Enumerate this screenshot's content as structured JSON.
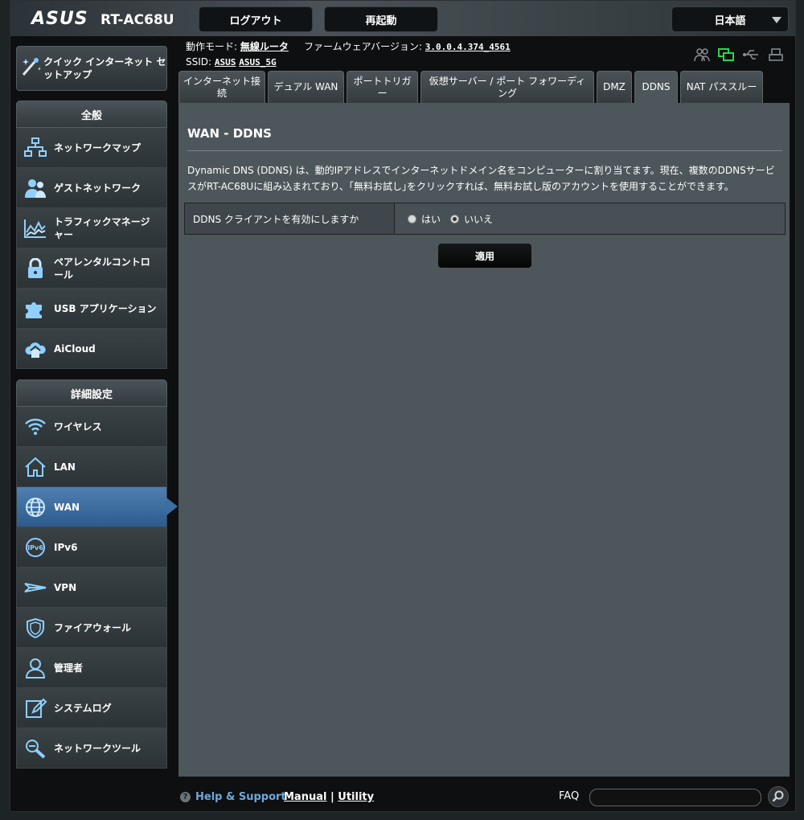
{
  "header": {
    "logo": "ASUS",
    "model": "RT-AC68U",
    "logout": "ログアウト",
    "reboot": "再起動",
    "language": "日本語"
  },
  "status": {
    "mode_label": "動作モード:",
    "mode_value": "無線ルータ",
    "fw_label": "ファームウェアバージョン:",
    "fw_value": "3.0.0.4.374_4561",
    "ssid_label": "SSID:",
    "ssid_1": "ASUS",
    "ssid_2": "ASUS_5G"
  },
  "sidebar": {
    "qis": "クイック インターネット セットアップ",
    "general_title": "全般",
    "general": [
      {
        "label": "ネットワークマップ",
        "icon": "network-map-icon"
      },
      {
        "label": "ゲストネットワーク",
        "icon": "guest-network-icon"
      },
      {
        "label": "トラフィックマネージャー",
        "icon": "traffic-manager-icon"
      },
      {
        "label": "ペアレンタルコントロール",
        "icon": "parental-control-icon"
      },
      {
        "label": "USB アプリケーション",
        "icon": "usb-app-icon"
      },
      {
        "label": "AiCloud",
        "icon": "aicloud-icon"
      }
    ],
    "advanced_title": "詳細設定",
    "advanced": [
      {
        "label": "ワイヤレス",
        "icon": "wireless-icon"
      },
      {
        "label": "LAN",
        "icon": "lan-icon"
      },
      {
        "label": "WAN",
        "icon": "wan-icon"
      },
      {
        "label": "IPv6",
        "icon": "ipv6-icon"
      },
      {
        "label": "VPN",
        "icon": "vpn-icon"
      },
      {
        "label": "ファイアウォール",
        "icon": "firewall-icon"
      },
      {
        "label": "管理者",
        "icon": "admin-icon"
      },
      {
        "label": "システムログ",
        "icon": "system-log-icon"
      },
      {
        "label": "ネットワークツール",
        "icon": "network-tools-icon"
      }
    ]
  },
  "tabs": [
    "インターネット接続",
    "デュアル WAN",
    "ポートトリガー",
    "仮想サーバー / ポート フォワーディング",
    "DMZ",
    "DDNS",
    "NAT パススルー"
  ],
  "main": {
    "title": "WAN - DDNS",
    "description": "Dynamic DNS (DDNS) は、動的IPアドレスでインターネットドメイン名をコンピューターに割り当てます。現在、複数のDDNSサービスがRT-AC68Uに組み込まれており、｢無料お試し｣をクリックすれば、無料お試し版のアカウントを使用することができます。",
    "field_label": "DDNS クライアントを有効にしますか",
    "opt_yes": "はい",
    "opt_no": "いいえ",
    "apply": "適用"
  },
  "footer": {
    "help": "Help & Support",
    "manual": "Manual",
    "sep": "|",
    "utility": "Utility",
    "faq": "FAQ"
  }
}
